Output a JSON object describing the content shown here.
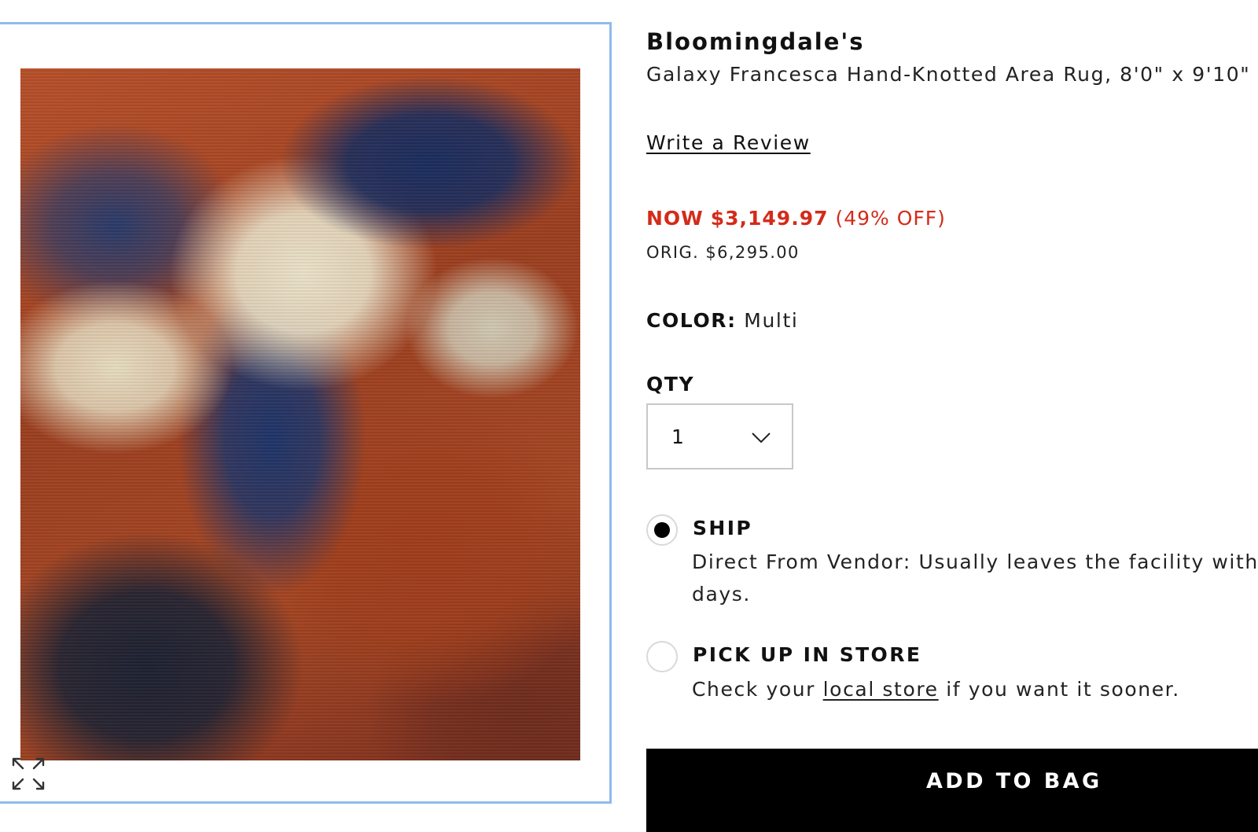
{
  "product": {
    "brand": "Bloomingdale's",
    "name": "Galaxy Francesca Hand-Knotted Area Rug, 8'0\" x 9'10\"",
    "write_review": "Write a Review",
    "price": {
      "now_prefix": "NOW",
      "now_amount": "$3,149.97",
      "discount": "(49% OFF)",
      "original": "ORIG. $6,295.00",
      "sale_color": "#d42b1a"
    },
    "color": {
      "label": "COLOR:",
      "value": "Multi"
    },
    "qty": {
      "label": "QTY",
      "selected": "1",
      "icon": "chevron-down-icon"
    }
  },
  "fulfillment": {
    "ship": {
      "title": "SHIP",
      "selected": true,
      "desc_line1": "Direct From Vendor: Usually leaves the facility within",
      "desc_line2": "days."
    },
    "pickup": {
      "title": "PICK UP IN STORE",
      "selected": false,
      "desc_before": "Check your",
      "desc_link": "local store",
      "desc_after": "if you want it sooner."
    }
  },
  "actions": {
    "add_to_bag": "ADD TO BAG"
  },
  "gallery": {
    "expand_icon": "expand-icon",
    "frame_color": "#8fbbea"
  }
}
